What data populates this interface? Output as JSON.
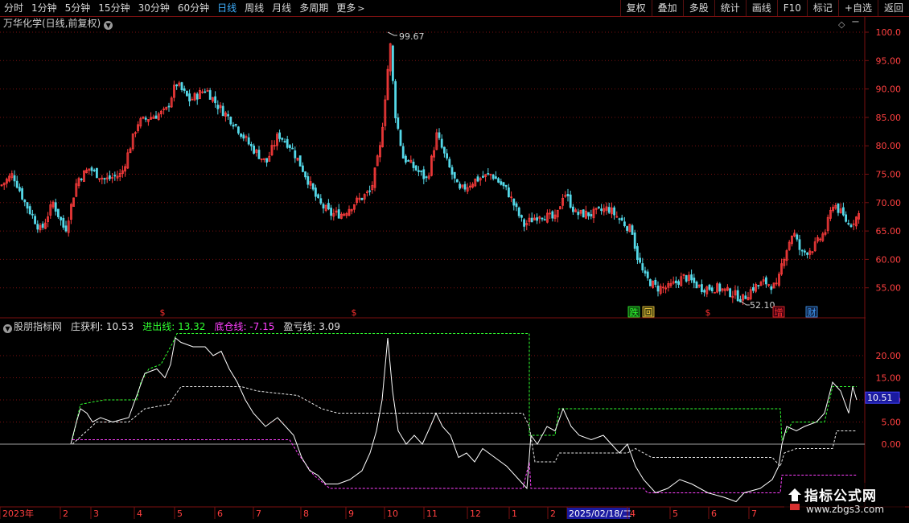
{
  "toolbar": {
    "left": [
      "分时",
      "1分钟",
      "5分钟",
      "15分钟",
      "30分钟",
      "60分钟",
      "日线",
      "周线",
      "月线",
      "多周期",
      "更多"
    ],
    "active": "日线",
    "right": [
      "复权",
      "叠加",
      "多股",
      "统计",
      "画线",
      "F10",
      "标记",
      "+自选",
      "返回"
    ]
  },
  "main_panel": {
    "title": "万华化学(日线,前复权)",
    "axis_ticks": [
      "100.0",
      "95.00",
      "90.00",
      "85.00",
      "80.00",
      "75.00",
      "70.00",
      "65.00",
      "60.00",
      "55.00"
    ],
    "high_label": "99.67",
    "low_label": "52.10",
    "markers": [
      {
        "text": "$",
        "color": "#ff3030"
      },
      {
        "text": "$",
        "color": "#ff3030"
      },
      {
        "text": "跌",
        "color": "#30ff30",
        "bg": "#105010"
      },
      {
        "text": "回",
        "color": "#ffd040",
        "bg": "#404010"
      },
      {
        "text": "$",
        "color": "#ff3030"
      },
      {
        "text": "增",
        "color": "#ff3030",
        "bg": "#400010"
      },
      {
        "text": "财",
        "color": "#40a0ff",
        "bg": "#102040"
      }
    ]
  },
  "indicator_panel": {
    "name": "股朋指标网",
    "series": [
      {
        "label": "庄获利: 10.53",
        "color": "#e0e0e0"
      },
      {
        "label": "进出线: 13.32",
        "color": "#30ff30"
      },
      {
        "label": "底仓线: -7.15",
        "color": "#ff40ff"
      },
      {
        "label": "盈亏线: 3.09",
        "color": "#e0e0e0"
      }
    ],
    "axis_ticks": [
      "20.00",
      "15.00",
      "10.00",
      "5.00",
      "0.00"
    ],
    "current_value_tag": "10.51"
  },
  "time_axis": {
    "labels": [
      "2023年",
      "2",
      "3",
      "4",
      "5",
      "6",
      "7",
      "8",
      "9",
      "10",
      "11",
      "12",
      "1",
      "2",
      "2025/02/18/二",
      "4",
      "5",
      "6",
      "7"
    ]
  },
  "watermark": {
    "title": "指标公式网",
    "url": "www.zbgs3.com"
  },
  "colors": {
    "up": "#ff3c3c",
    "down": "#54d8e8",
    "grid": "#7a1010",
    "axis_text": "#ff4040"
  }
}
